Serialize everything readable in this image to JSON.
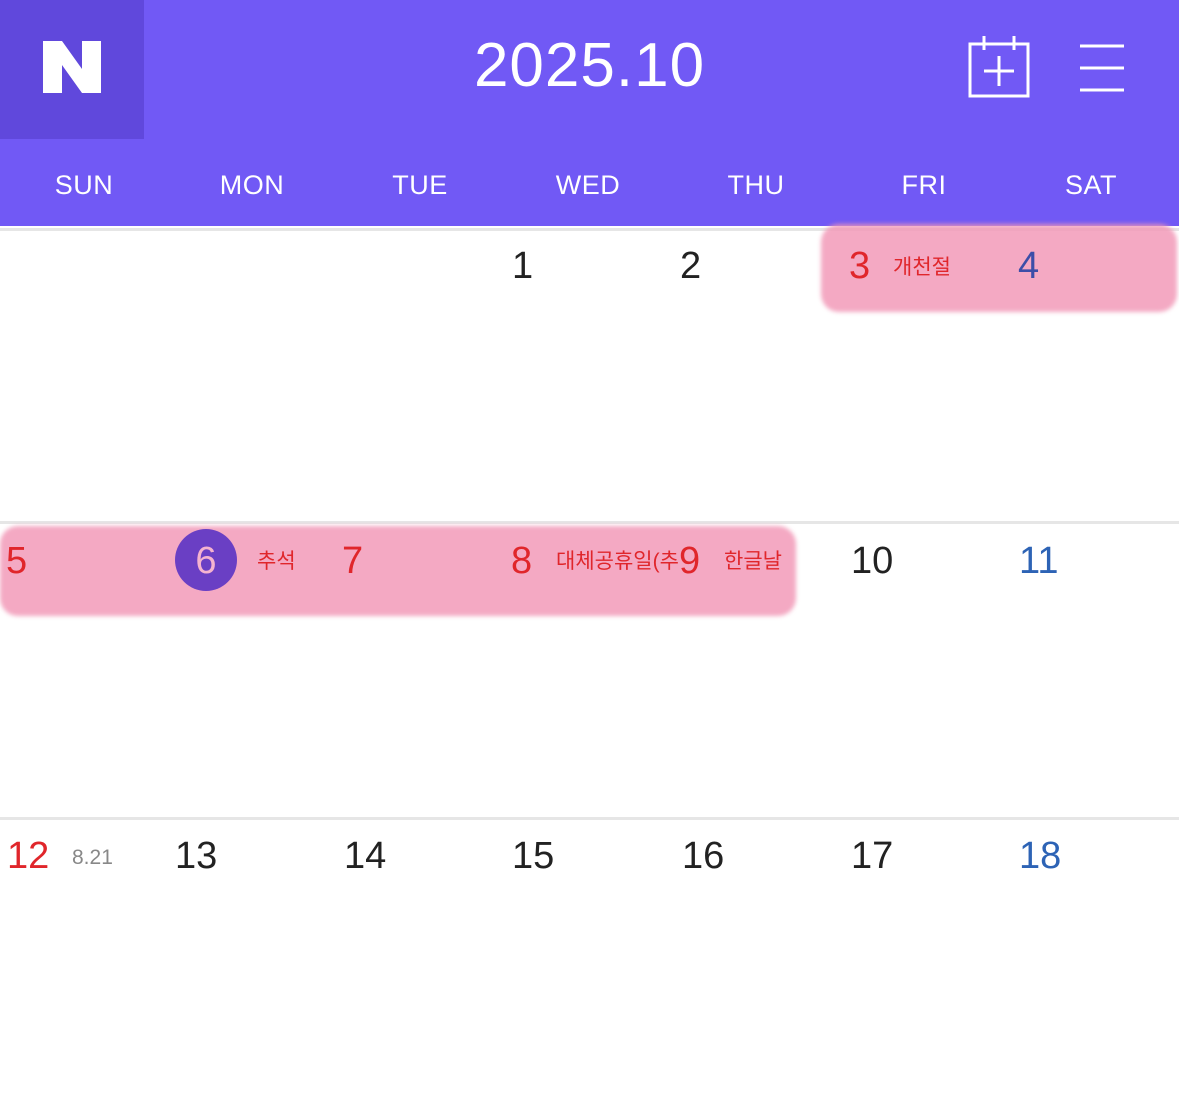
{
  "header": {
    "logo_letter": "N",
    "month_title": "2025.10",
    "add_icon": "calendar-plus-icon",
    "menu_icon": "hamburger-menu-icon",
    "background": "#7159f5",
    "logo_background": "#6048dc"
  },
  "weekdays": [
    "SUN",
    "MON",
    "TUE",
    "WED",
    "THU",
    "FRI",
    "SAT"
  ],
  "weeks": [
    {
      "days": [
        {
          "num": "1"
        },
        {
          "num": "2"
        },
        {
          "num": "3",
          "holiday": "개천절"
        },
        {
          "num": "4"
        }
      ]
    },
    {
      "days": [
        {
          "num": "5"
        },
        {
          "num": "6",
          "holiday": "추석",
          "today": true
        },
        {
          "num": "7"
        },
        {
          "num": "8",
          "holiday": "대체공휴일(추"
        },
        {
          "num": "9",
          "holiday": "한글날"
        },
        {
          "num": "10"
        },
        {
          "num": "11"
        }
      ]
    },
    {
      "days": [
        {
          "num": "12",
          "lunar": "8.21"
        },
        {
          "num": "13"
        },
        {
          "num": "14"
        },
        {
          "num": "15"
        },
        {
          "num": "16"
        },
        {
          "num": "17"
        },
        {
          "num": "18"
        }
      ]
    }
  ],
  "colors": {
    "holiday_red": "#e0262b",
    "saturday_blue": "#2d63b5",
    "holiday_band": "#f296b6",
    "today_circle": "#6a3fc4"
  }
}
